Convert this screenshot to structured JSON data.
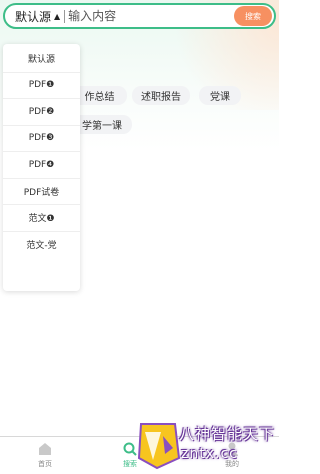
{
  "search": {
    "source_label": "默认源",
    "placeholder": "输入内容",
    "button_label": "搜索"
  },
  "tags": [
    "作总结",
    "述职报告",
    "党课",
    "学第一课"
  ],
  "dropdown": {
    "items": [
      "默认源",
      "PDF❶",
      "PDF❷",
      "PDF❸",
      "PDF❹",
      "PDF试卷",
      "范文❶",
      "范文-党"
    ]
  },
  "bottom_nav": {
    "items": [
      {
        "label": "首页",
        "icon": "home-icon",
        "active": false
      },
      {
        "label": "搜索",
        "icon": "search-icon",
        "active": true
      },
      {
        "label": "我的",
        "icon": "user-icon",
        "active": false
      }
    ]
  },
  "watermark": {
    "line1": "八神智能天下",
    "line2": "zntx.cc"
  },
  "colors": {
    "accent": "#3dbd88",
    "button": "#f79061"
  }
}
